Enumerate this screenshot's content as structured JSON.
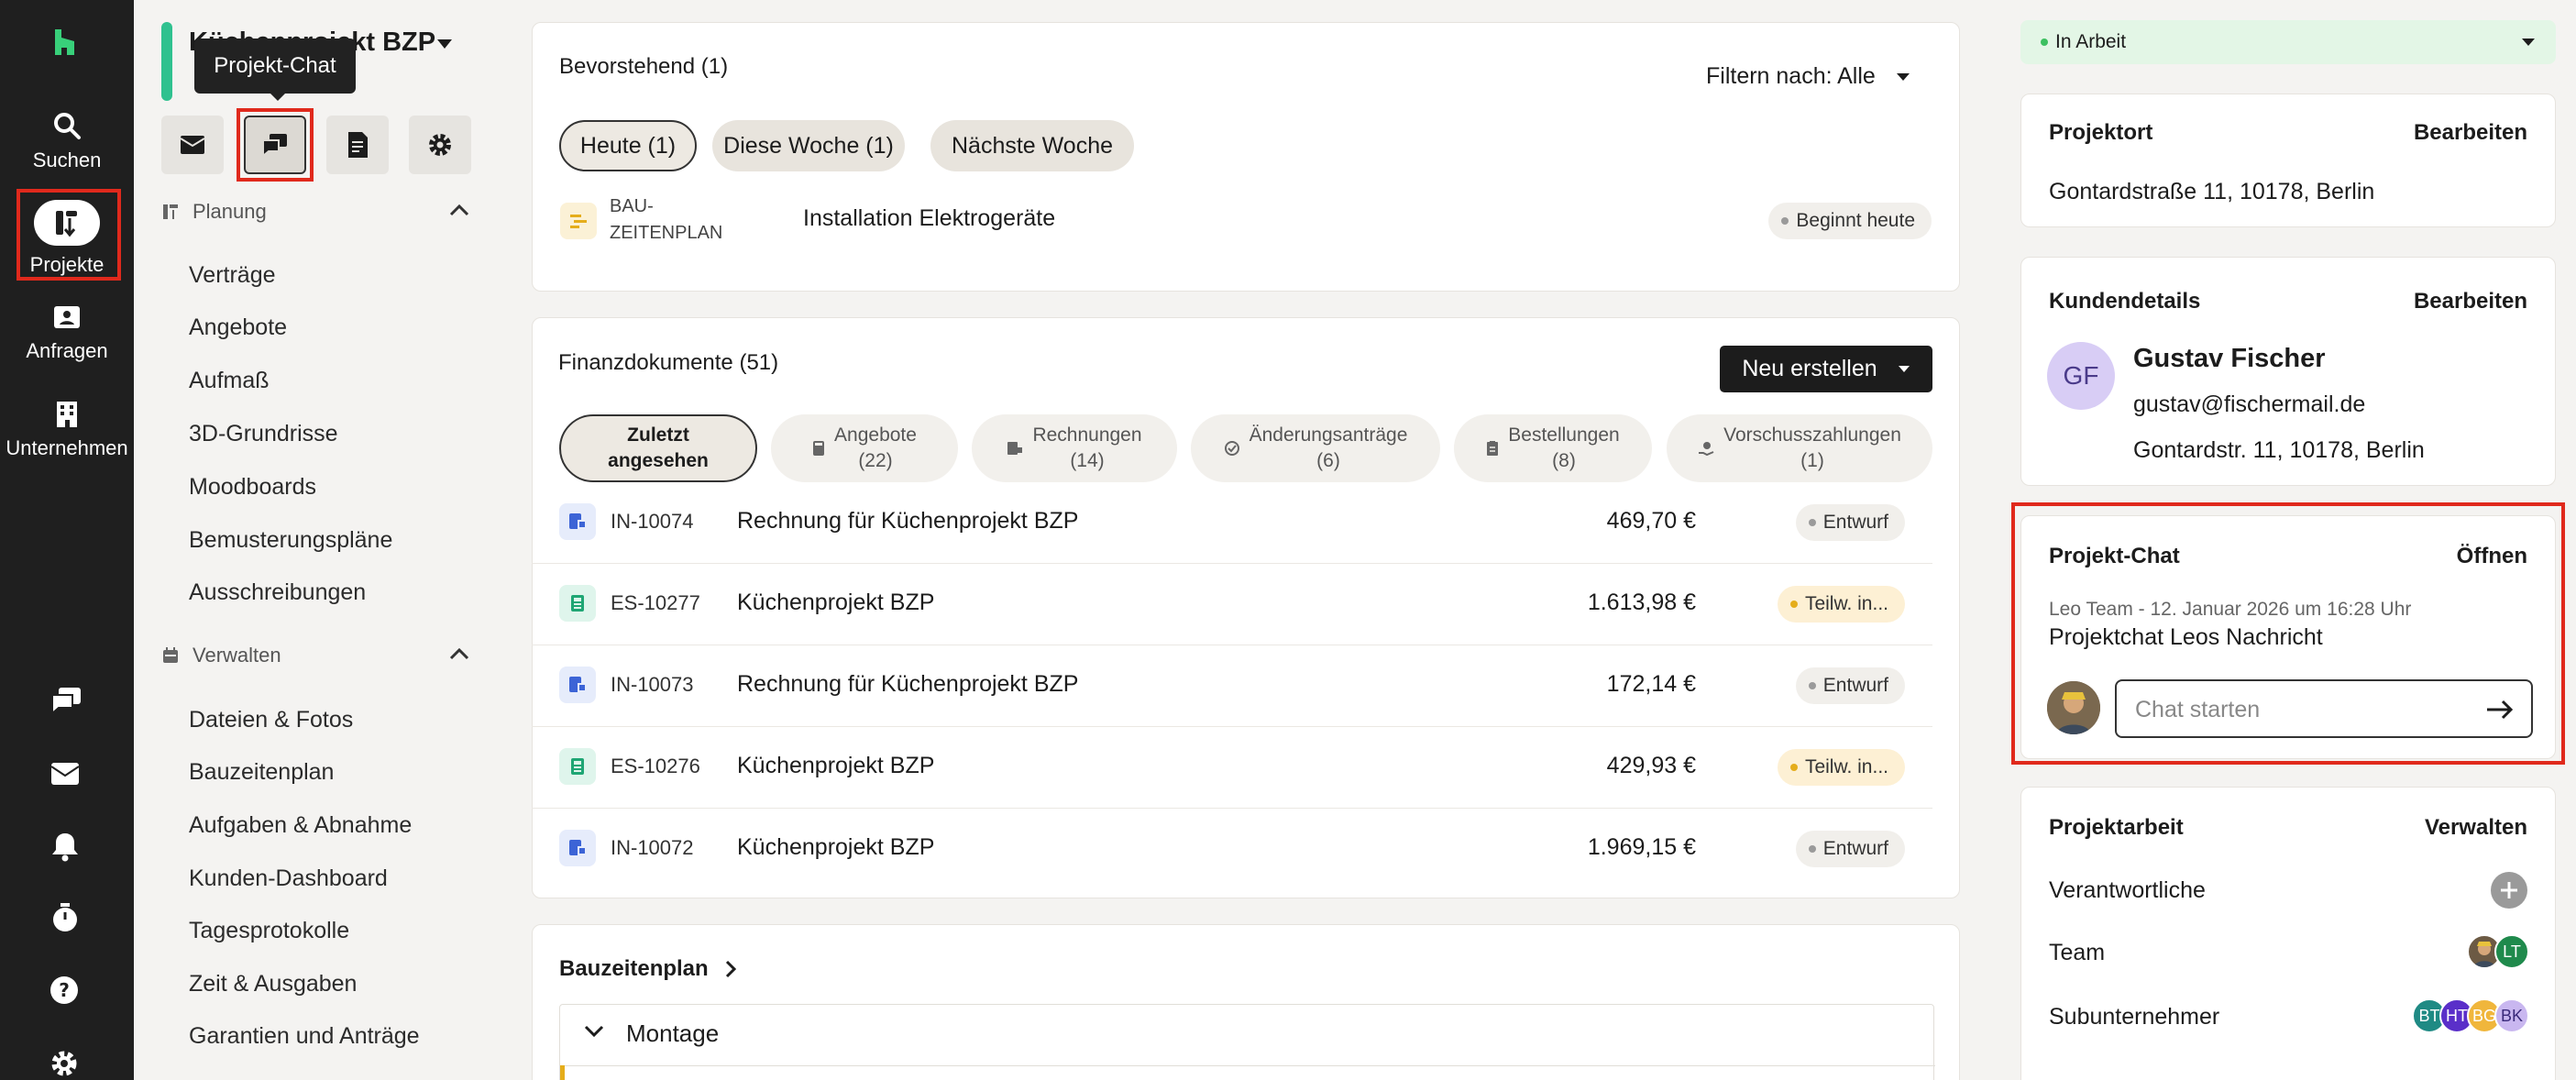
{
  "rail": {
    "items": [
      {
        "label": "Suchen",
        "icon": "search-icon"
      },
      {
        "label": "Projekte",
        "icon": "projects-icon"
      },
      {
        "label": "Anfragen",
        "icon": "inbox-contact-icon"
      },
      {
        "label": "Unternehmen",
        "icon": "building-icon"
      }
    ],
    "bottom_icons": [
      "chat-icon",
      "mail-icon",
      "bell-icon",
      "timer-icon",
      "help-icon",
      "settings-icon"
    ]
  },
  "sidebar": {
    "project_title": "Küchenprojekt BZP",
    "tooltip": "Projekt-Chat",
    "planning": {
      "heading": "Planung",
      "items": [
        "Verträge",
        "Angebote",
        "Aufmaß",
        "3D-Grundrisse",
        "Moodboards",
        "Bemusterungspläne",
        "Ausschreibungen"
      ]
    },
    "manage": {
      "heading": "Verwalten",
      "items": [
        "Dateien & Fotos",
        "Bauzeitenplan",
        "Aufgaben & Abnahme",
        "Kunden-Dashboard",
        "Tagesprotokolle",
        "Zeit & Ausgaben",
        "Garantien und Anträge"
      ]
    }
  },
  "upcoming": {
    "title": "Bevorstehend (1)",
    "filter": "Filtern nach: Alle",
    "pills": [
      "Heute (1)",
      "Diese Woche (1)",
      "Nächste Woche"
    ],
    "item": {
      "type_line1": "BAU-",
      "type_line2": "ZEITENPLAN",
      "title": "Installation Elektrogeräte",
      "status": "Beginnt heute"
    }
  },
  "finance": {
    "title": "Finanzdokumente (51)",
    "new_button": "Neu erstellen",
    "tabs": [
      {
        "l1": "Zuletzt",
        "l2": "angesehen"
      },
      {
        "l1": "Angebote",
        "l2": "(22)"
      },
      {
        "l1": "Rechnungen",
        "l2": "(14)"
      },
      {
        "l1": "Änderungsanträge",
        "l2": "(6)"
      },
      {
        "l1": "Bestellungen",
        "l2": "(8)"
      },
      {
        "l1": "Vorschusszahlungen",
        "l2": "(1)"
      }
    ],
    "rows": [
      {
        "num": "IN-10074",
        "title": "Rechnung für Küchenprojekt BZP",
        "amount": "469,70 €",
        "status": "Entwurf"
      },
      {
        "num": "ES-10277",
        "title": "Küchenprojekt BZP",
        "amount": "1.613,98 €",
        "status": "Teilw. in..."
      },
      {
        "num": "IN-10073",
        "title": "Rechnung für Küchenprojekt BZP",
        "amount": "172,14 €",
        "status": "Entwurf"
      },
      {
        "num": "ES-10276",
        "title": "Küchenprojekt BZP",
        "amount": "429,93 €",
        "status": "Teilw. in..."
      },
      {
        "num": "IN-10072",
        "title": "Küchenprojekt BZP",
        "amount": "1.969,15 €",
        "status": "Entwurf"
      }
    ]
  },
  "schedule": {
    "title": "Bauzeitenplan",
    "group": "Montage"
  },
  "right": {
    "status": "In Arbeit",
    "location": {
      "title": "Projektort",
      "action": "Bearbeiten",
      "address": "Gontardstraße 11, 10178, Berlin"
    },
    "customer": {
      "title": "Kundendetails",
      "action": "Bearbeiten",
      "initials": "GF",
      "name": "Gustav Fischer",
      "email": "gustav@fischermail.de",
      "address": "Gontardstr. 11, 10178, Berlin"
    },
    "chat": {
      "title": "Projekt-Chat",
      "action": "Öffnen",
      "meta": "Leo Team - 12. Januar 2026 um 16:28 Uhr",
      "message": "Projektchat Leos Nachricht",
      "placeholder": "Chat starten"
    },
    "work": {
      "title": "Projektarbeit",
      "action": "Verwalten",
      "responsible": "Verantwortliche",
      "team": "Team",
      "subs": "Subunternehmer",
      "team_initials": "LT",
      "sub_initials": [
        "BT",
        "HT",
        "BG",
        "BK"
      ]
    }
  },
  "colors": {
    "accent_green": "#2fc18f",
    "highlight_red": "#e0291c",
    "rail_bg": "#1f1f1f"
  }
}
